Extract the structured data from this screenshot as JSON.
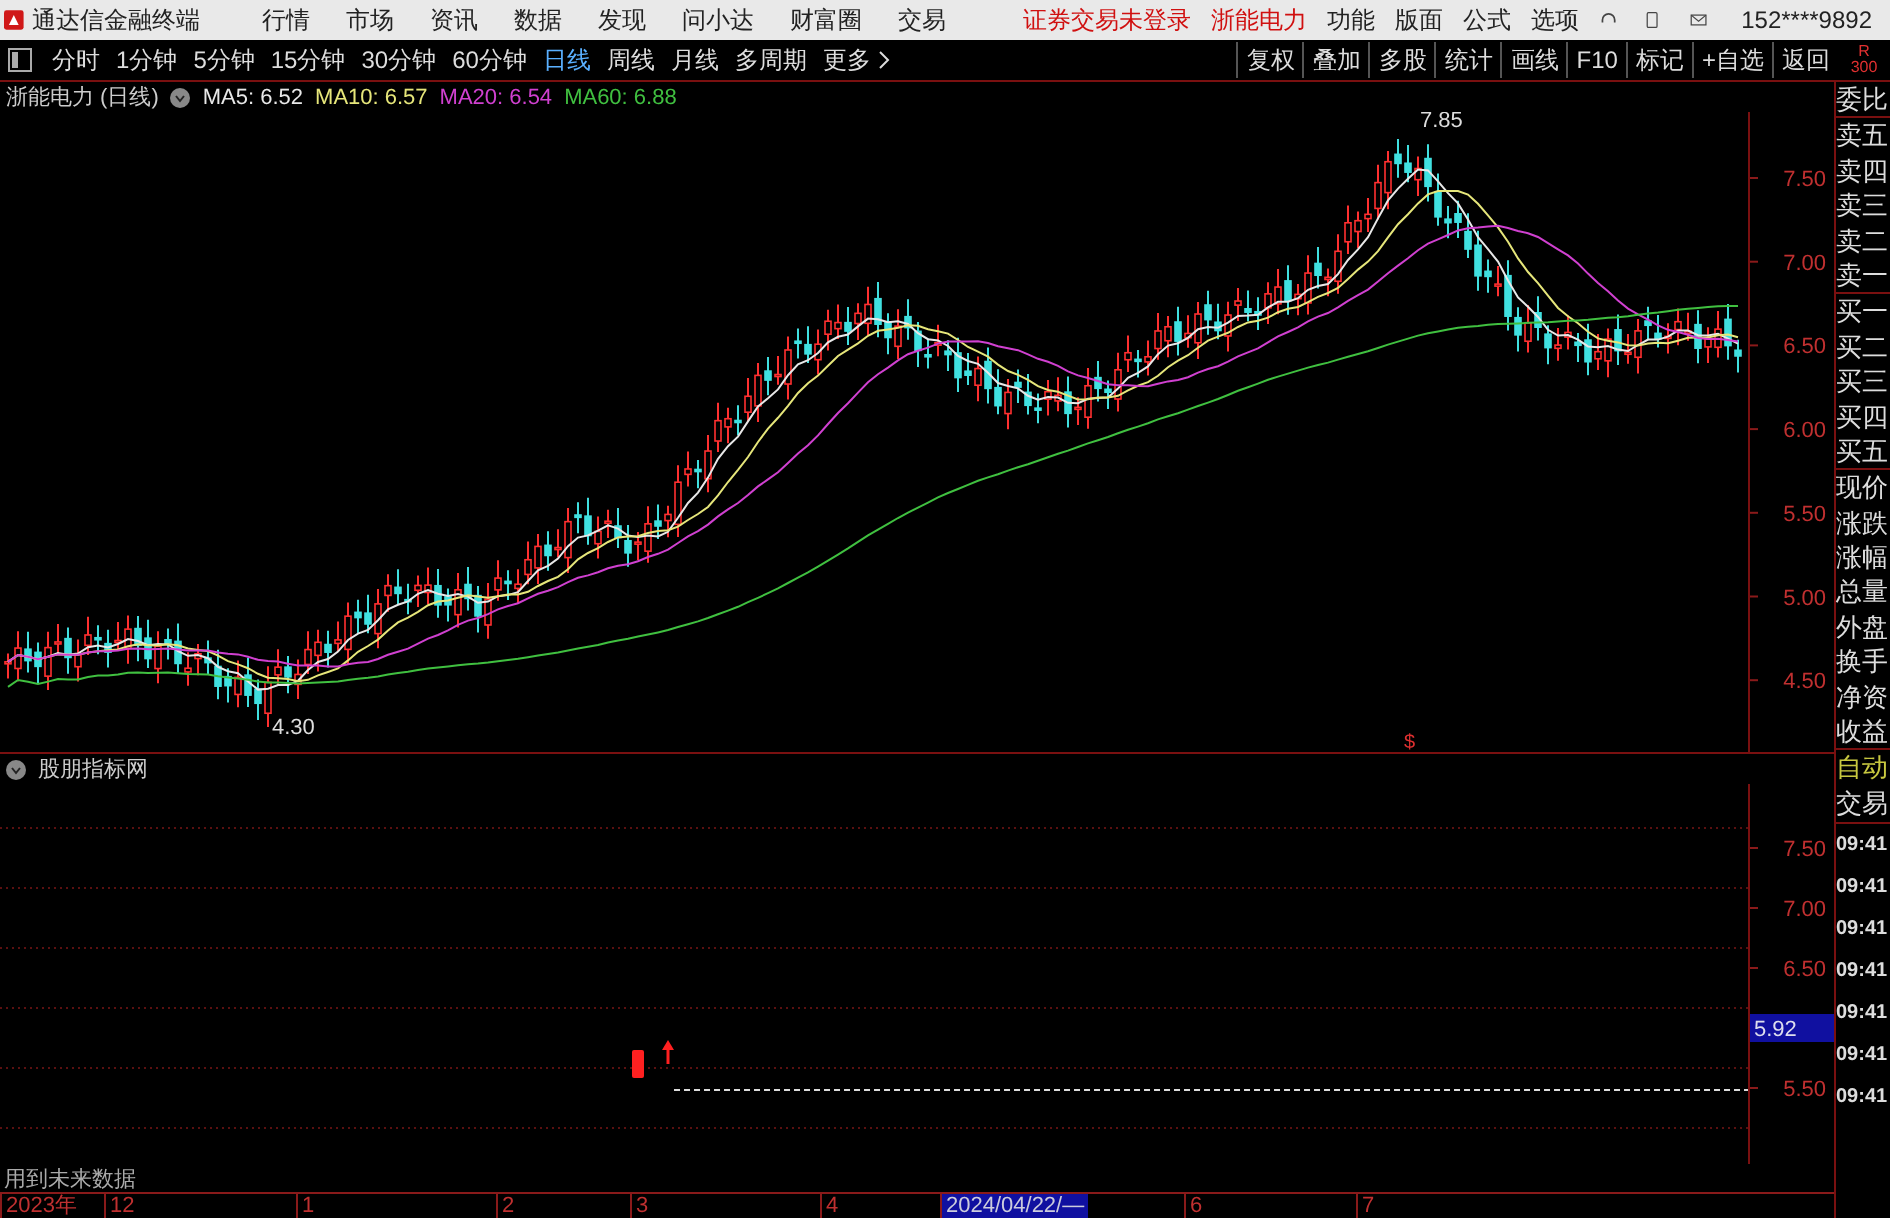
{
  "app": {
    "title": "通达信金融终端"
  },
  "menu": [
    "行情",
    "市场",
    "资讯",
    "数据",
    "发现",
    "问小达",
    "财富圈",
    "交易"
  ],
  "status": [
    "证券交易未登录",
    "浙能电力"
  ],
  "menu_right": [
    "功能",
    "版面",
    "公式",
    "选项"
  ],
  "account": "152****9892",
  "periods": [
    {
      "label": "分时",
      "selected": false
    },
    {
      "label": "1分钟",
      "selected": false
    },
    {
      "label": "5分钟",
      "selected": false
    },
    {
      "label": "15分钟",
      "selected": false
    },
    {
      "label": "30分钟",
      "selected": false
    },
    {
      "label": "60分钟",
      "selected": false
    },
    {
      "label": "日线",
      "selected": true
    },
    {
      "label": "周线",
      "selected": false
    },
    {
      "label": "月线",
      "selected": false
    },
    {
      "label": "多周期",
      "selected": false
    },
    {
      "label": "更多",
      "selected": false
    }
  ],
  "tools": [
    "复权",
    "叠加",
    "多股",
    "统计",
    "画线",
    "F10",
    "标记",
    "+自选",
    "返回"
  ],
  "corner_badge": [
    "R",
    "300"
  ],
  "main_chart": {
    "title": "浙能电力 (日线)",
    "indicators": [
      {
        "label": "MA5: 6.52",
        "color": "#e8e8e8"
      },
      {
        "label": "MA10: 6.57",
        "color": "#e6e67a"
      },
      {
        "label": "MA20: 6.54",
        "color": "#d040d0"
      },
      {
        "label": "MA60: 6.88",
        "color": "#40c040"
      }
    ],
    "price_axis": [
      "7.50",
      "7.00",
      "6.50",
      "6.00",
      "5.50",
      "5.00",
      "4.50"
    ],
    "high_label": "7.85",
    "low_label": "4.30",
    "marker": "$"
  },
  "lower_chart": {
    "title": "股朋指标网",
    "price_axis": [
      "7.50",
      "7.00",
      "6.50",
      "5.50"
    ],
    "current_price": "5.92",
    "footer": "用到未来数据"
  },
  "time_axis": [
    "2023年",
    "12",
    "1",
    "2",
    "3",
    "4",
    "2024/04/22/—",
    "6",
    "7"
  ],
  "quote_panel": [
    "委比",
    "卖五",
    "卖四",
    "卖三",
    "卖二",
    "卖一",
    "买一",
    "买二",
    "买三",
    "买四",
    "买五",
    "现价",
    "涨跌",
    "涨幅",
    "总量",
    "外盘",
    "换手",
    "净资",
    "收益"
  ],
  "trade_panel": {
    "mode": "自动",
    "title": "交易",
    "times": [
      "09:41",
      "09:41",
      "09:41",
      "09:41",
      "09:41",
      "09:41",
      "09:41"
    ]
  }
}
